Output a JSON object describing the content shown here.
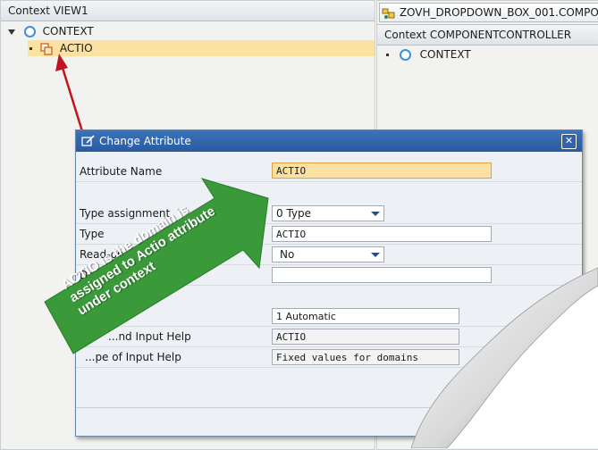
{
  "left_pane": {
    "header": "Context VIEW1",
    "root_label": "CONTEXT",
    "selected_attr": "ACTIO"
  },
  "right_pane": {
    "tab_label": "ZOVH_DROPDOWN_BOX_001.COMPO",
    "header": "Context COMPONENTCONTROLLER",
    "root_label": "CONTEXT"
  },
  "dialog": {
    "title": "Change Attribute",
    "close_label": "✕",
    "fields": {
      "attribute_name": {
        "label": "Attribute Name",
        "value": "ACTIO"
      },
      "type_assignment": {
        "label": "Type assignment",
        "value": "0 Type"
      },
      "type": {
        "label": "Type",
        "value": "ACTIO"
      },
      "read_only": {
        "label": "Read-only",
        "value": "No"
      },
      "default": {
        "label": "Def",
        "value": ""
      },
      "input_help_mode": {
        "label": "",
        "value": "1 Automatic"
      },
      "assigned_input_help": {
        "label": "...nd Input Help",
        "value": "ACTIO"
      },
      "type_of_input_help": {
        "label": "...pe of Input Help",
        "value": "Fixed values for domains"
      }
    }
  },
  "callout": {
    "text": "ACTIO is the domain is assigned to Actio attribute under context",
    "color": "#3a9a3a"
  },
  "colors": {
    "selection": "#fbe2a2",
    "dialog_title": "#2a5aa0",
    "arrow": "#c0161f"
  }
}
